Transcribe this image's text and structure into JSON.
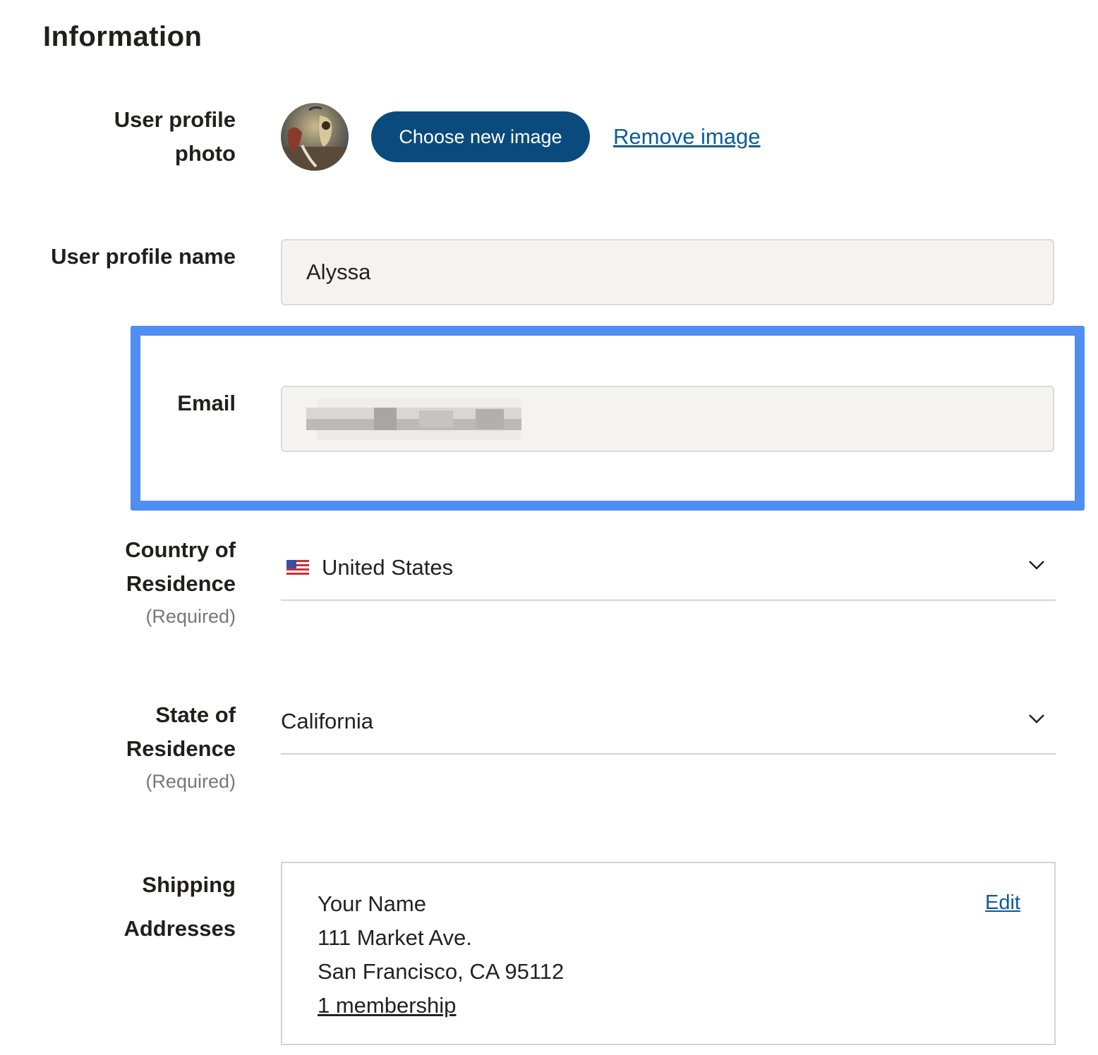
{
  "page": {
    "title": "Information"
  },
  "photo": {
    "label_line1": "User profile",
    "label_line2": "photo",
    "choose_button": "Choose new image",
    "remove_link": "Remove image"
  },
  "name": {
    "label": "User profile name",
    "value": "Alyssa"
  },
  "email": {
    "label": "Email"
  },
  "country": {
    "label_line1": "Country of",
    "label_line2": "Residence",
    "required": "(Required)",
    "value": "United States",
    "flag_icon": "us-flag-icon"
  },
  "state": {
    "label_line1": "State of",
    "label_line2": "Residence",
    "required": "(Required)",
    "value": "California"
  },
  "shipping": {
    "label_line1": "Shipping",
    "label_line2": "Addresses",
    "name": "Your Name",
    "street": "111 Market Ave.",
    "city_line": "San Francisco, CA 95112",
    "membership_link": "1 membership",
    "edit_link": "Edit"
  },
  "colors": {
    "primary_button": "#0b4a7d",
    "link": "#0b5c99",
    "focus_outline": "#4f8ef2",
    "input_bg": "#f4f3f1"
  }
}
